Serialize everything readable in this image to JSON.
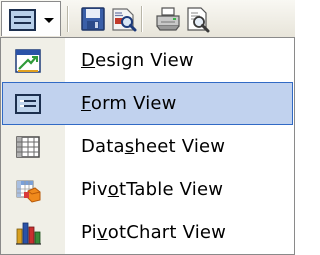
{
  "toolbar": {
    "buttons": [
      {
        "name": "view",
        "icon": "form-view-icon",
        "has_dropdown": true
      },
      {
        "name": "save",
        "icon": "save-icon"
      },
      {
        "name": "search",
        "icon": "file-search-icon"
      },
      {
        "name": "print",
        "icon": "printer-icon"
      },
      {
        "name": "print-preview",
        "icon": "print-preview-icon"
      }
    ]
  },
  "menu": {
    "selected_index": 1,
    "highlight_color": "#c1d2ee",
    "highlight_border": "#316ac5",
    "items": [
      {
        "label": "Design View",
        "accel_index": 0,
        "icon": "design-view-icon"
      },
      {
        "label": "Form View",
        "accel_index": 0,
        "icon": "form-view-icon"
      },
      {
        "label": "Datasheet View",
        "accel_index": 4,
        "icon": "datasheet-view-icon"
      },
      {
        "label": "PivotTable View",
        "accel_index": 3,
        "icon": "pivottable-view-icon"
      },
      {
        "label": "PivotChart View",
        "accel_index": 2,
        "icon": "pivotchart-view-icon"
      }
    ]
  }
}
